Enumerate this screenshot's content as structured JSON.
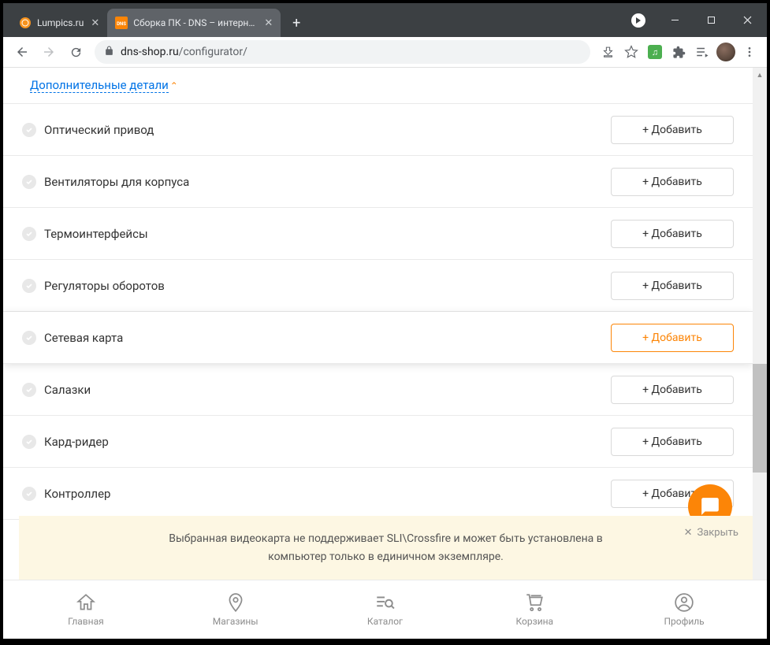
{
  "browser": {
    "tabs": [
      {
        "title": "Lumpics.ru",
        "favicon": "orange-circle"
      },
      {
        "title": "Сборка ПК - DNS – интернет ма",
        "favicon": "dns-logo"
      }
    ],
    "url_domain": "dns-shop.ru",
    "url_path": "/configurator/"
  },
  "page": {
    "additional_details_label": "Дополнительные детали",
    "add_button_label": "+ Добавить",
    "categories": [
      {
        "label": "Оптический привод",
        "highlight": false
      },
      {
        "label": "Вентиляторы для корпуса",
        "highlight": false
      },
      {
        "label": "Термоинтерфейсы",
        "highlight": false
      },
      {
        "label": "Регуляторы оборотов",
        "highlight": false
      },
      {
        "label": "Сетевая карта",
        "highlight": true
      },
      {
        "label": "Салазки",
        "highlight": false
      },
      {
        "label": "Кард-ридер",
        "highlight": false
      },
      {
        "label": "Контроллер",
        "highlight": false
      }
    ],
    "banner": {
      "text": "Выбранная видеокарта не поддерживает SLI\\Crossfire и может быть установлена в компьютер только в единичном экземпляре.",
      "close_label": "Закрыть"
    },
    "bottom_nav": [
      {
        "label": "Главная",
        "icon": "home"
      },
      {
        "label": "Магазины",
        "icon": "pin"
      },
      {
        "label": "Каталог",
        "icon": "catalog"
      },
      {
        "label": "Корзина",
        "icon": "cart"
      },
      {
        "label": "Профиль",
        "icon": "profile"
      }
    ]
  }
}
